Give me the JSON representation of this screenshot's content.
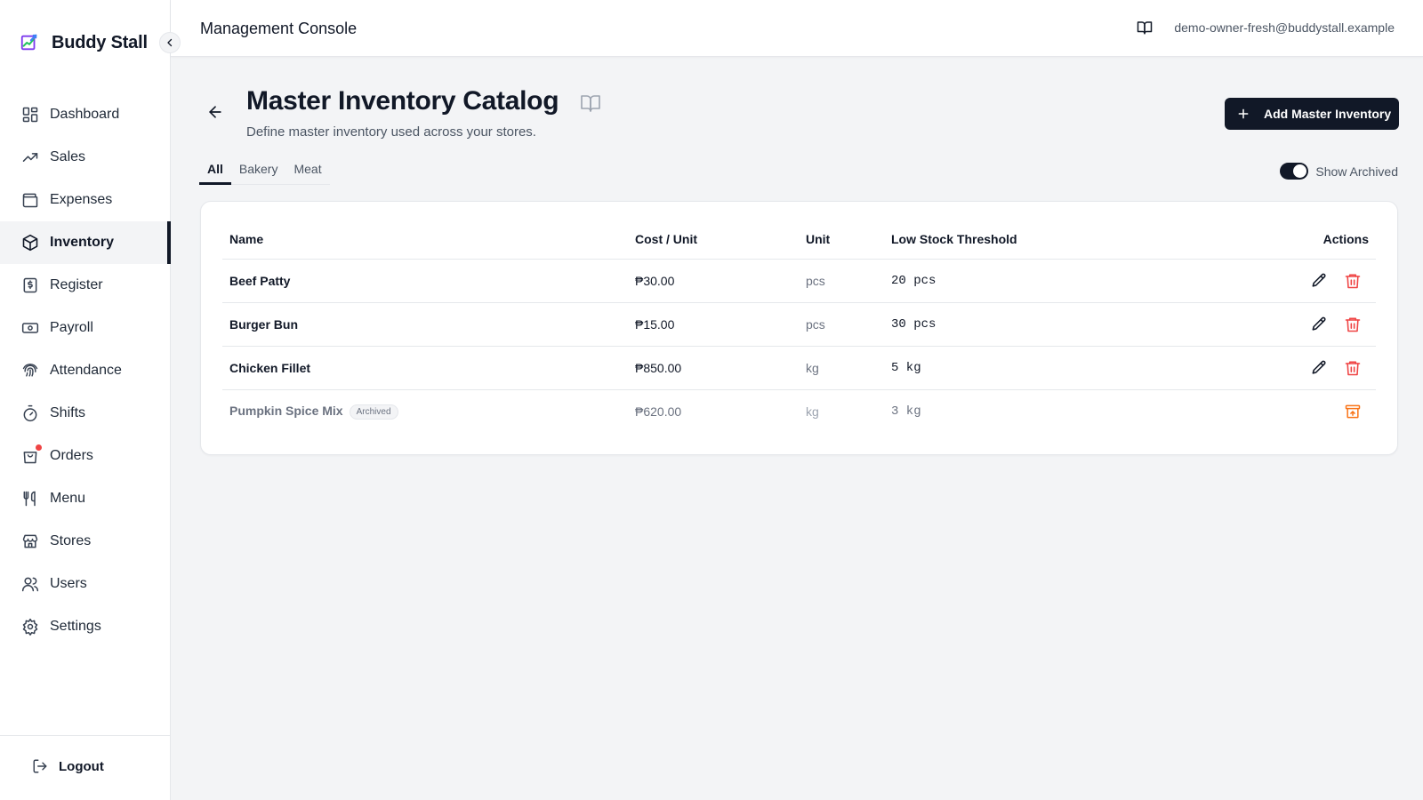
{
  "brand": {
    "name": "Buddy Stall",
    "logo_icon": "chart-logo-icon"
  },
  "sidebar": {
    "items": [
      {
        "label": "Dashboard",
        "icon": "dashboard-icon",
        "active": false
      },
      {
        "label": "Sales",
        "icon": "trending-up-icon",
        "active": false
      },
      {
        "label": "Expenses",
        "icon": "wallet-icon",
        "active": false
      },
      {
        "label": "Inventory",
        "icon": "box-icon",
        "active": true
      },
      {
        "label": "Register",
        "icon": "receipt-icon",
        "active": false
      },
      {
        "label": "Payroll",
        "icon": "banknote-icon",
        "active": false
      },
      {
        "label": "Attendance",
        "icon": "fingerprint-icon",
        "active": false
      },
      {
        "label": "Shifts",
        "icon": "timer-icon",
        "active": false
      },
      {
        "label": "Orders",
        "icon": "shopping-bag-icon",
        "active": false,
        "notification": true
      },
      {
        "label": "Menu",
        "icon": "utensils-icon",
        "active": false
      },
      {
        "label": "Stores",
        "icon": "store-icon",
        "active": false
      },
      {
        "label": "Users",
        "icon": "users-icon",
        "active": false
      },
      {
        "label": "Settings",
        "icon": "gear-icon",
        "active": false
      }
    ],
    "logout_label": "Logout"
  },
  "topbar": {
    "title": "Management Console",
    "user_email": "demo-owner-fresh@buddystall.example"
  },
  "page": {
    "title": "Master Inventory Catalog",
    "subtitle": "Define master inventory used across your stores.",
    "add_button_label": "Add Master Inventory"
  },
  "tabs": [
    {
      "label": "All",
      "active": true
    },
    {
      "label": "Bakery",
      "active": false
    },
    {
      "label": "Meat",
      "active": false
    }
  ],
  "show_archived": {
    "label": "Show Archived",
    "enabled": true
  },
  "table": {
    "headers": [
      "Name",
      "Cost / Unit",
      "Unit",
      "Low Stock Threshold",
      "Actions"
    ],
    "rows": [
      {
        "name": "Beef Patty",
        "cost": "₱30.00",
        "unit": "pcs",
        "threshold": "20 pcs",
        "archived": false
      },
      {
        "name": "Burger Bun",
        "cost": "₱15.00",
        "unit": "pcs",
        "threshold": "30 pcs",
        "archived": false
      },
      {
        "name": "Chicken Fillet",
        "cost": "₱850.00",
        "unit": "kg",
        "threshold": "5 kg",
        "archived": false
      },
      {
        "name": "Pumpkin Spice Mix",
        "cost": "₱620.00",
        "unit": "kg",
        "threshold": "3 kg",
        "archived": true,
        "badge": "Archived"
      }
    ]
  },
  "colors": {
    "primary": "#111827",
    "danger": "#ef4444",
    "restore": "#f97316",
    "background": "#f3f4f6"
  }
}
